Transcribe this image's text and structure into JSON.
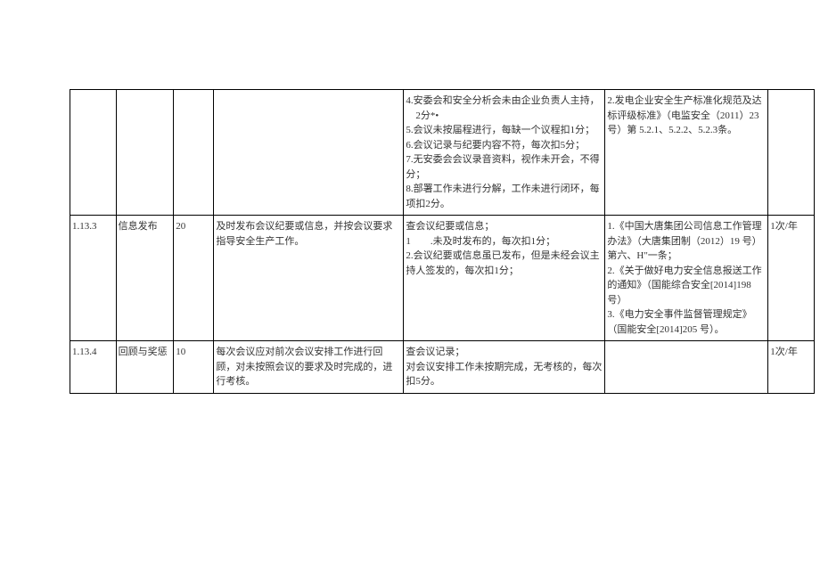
{
  "rows": [
    {
      "id": "",
      "name": "",
      "score": "",
      "desc": "",
      "criteria": "4.安委会和安全分析会未由企业负责人主持，\n　2分*•\n5.会议未按届程进行，每缺一个议程扣1分；\n6.会议记录与纪要内容不符，每次扣5分；\n7.无安委会会议录音资料，视作未开会，不得分；\n8.部署工作未进行分解，工作未进行闭环，每项扣2分。",
      "basis": "2.发电企业安全生产标准化规范及达标评级标准》（电监安全（2011）23 号）第 5.2.1、5.2.2、5.2.3条。",
      "freq": ""
    },
    {
      "id": "1.13.3",
      "name": "信息发布",
      "score": "20",
      "desc": "及时发布会议纪要或信息，并按会议要求指导安全生产工作。",
      "criteria": "查会议纪要或信息；\n1　　.未及时发布的，每次扣1分；\n2.会议纪要或信息虽已发布，但是未经会议主持人签发的，每次扣1分；",
      "basis": "1.《中国大唐集团公司信息工作管理办法》（大唐集团制（2012）19 号）第六、H\"一条；\n2.《关于做好电力安全信息报送工作的通知》（国能综合安全[2014]198 号）\n3.《电力安全事件监督管理规定》（国能安全[2014]205 号）。",
      "freq": "1次/年"
    },
    {
      "id": "1.13.4",
      "name": "回顾与奖惩",
      "score": "10",
      "desc": "每次会议应对前次会议安排工作进行回顾，对未按照会议的要求及时完成的，进行考核。",
      "criteria": "查会议记录；\n对会议安排工作未按期完成，无考核的，每次扣5分。",
      "basis": "",
      "freq": "1次/年"
    }
  ]
}
